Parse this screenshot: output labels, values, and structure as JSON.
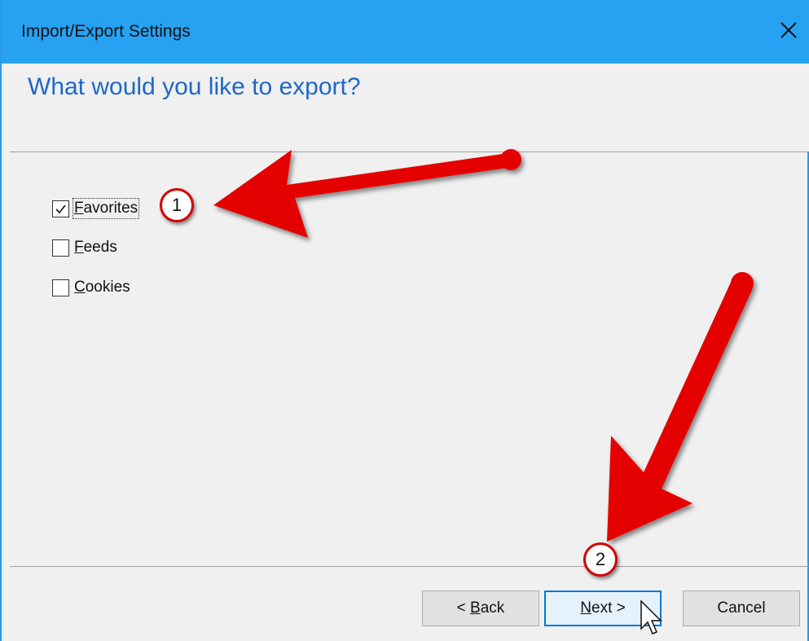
{
  "window": {
    "title": "Import/Export Settings",
    "close_icon": "close-icon"
  },
  "page": {
    "heading": "What would you like to export?"
  },
  "options": [
    {
      "label": "Favorites",
      "accel": "F",
      "rest": "avorites",
      "checked": true
    },
    {
      "label": "Feeds",
      "accel": "F",
      "rest": "eeds",
      "checked": false
    },
    {
      "label": "Cookies",
      "accel": "C",
      "rest": "ookies",
      "checked": false
    }
  ],
  "buttons": {
    "back": {
      "prefix": "< ",
      "accel": "B",
      "rest": "ack"
    },
    "next": {
      "accel": "N",
      "rest": "ext >"
    },
    "cancel": "Cancel"
  },
  "annotations": {
    "badge1": "1",
    "badge2": "2"
  },
  "colors": {
    "titlebar": "#27a2f3",
    "heading": "#1e68c8",
    "arrow": "#e50000"
  }
}
